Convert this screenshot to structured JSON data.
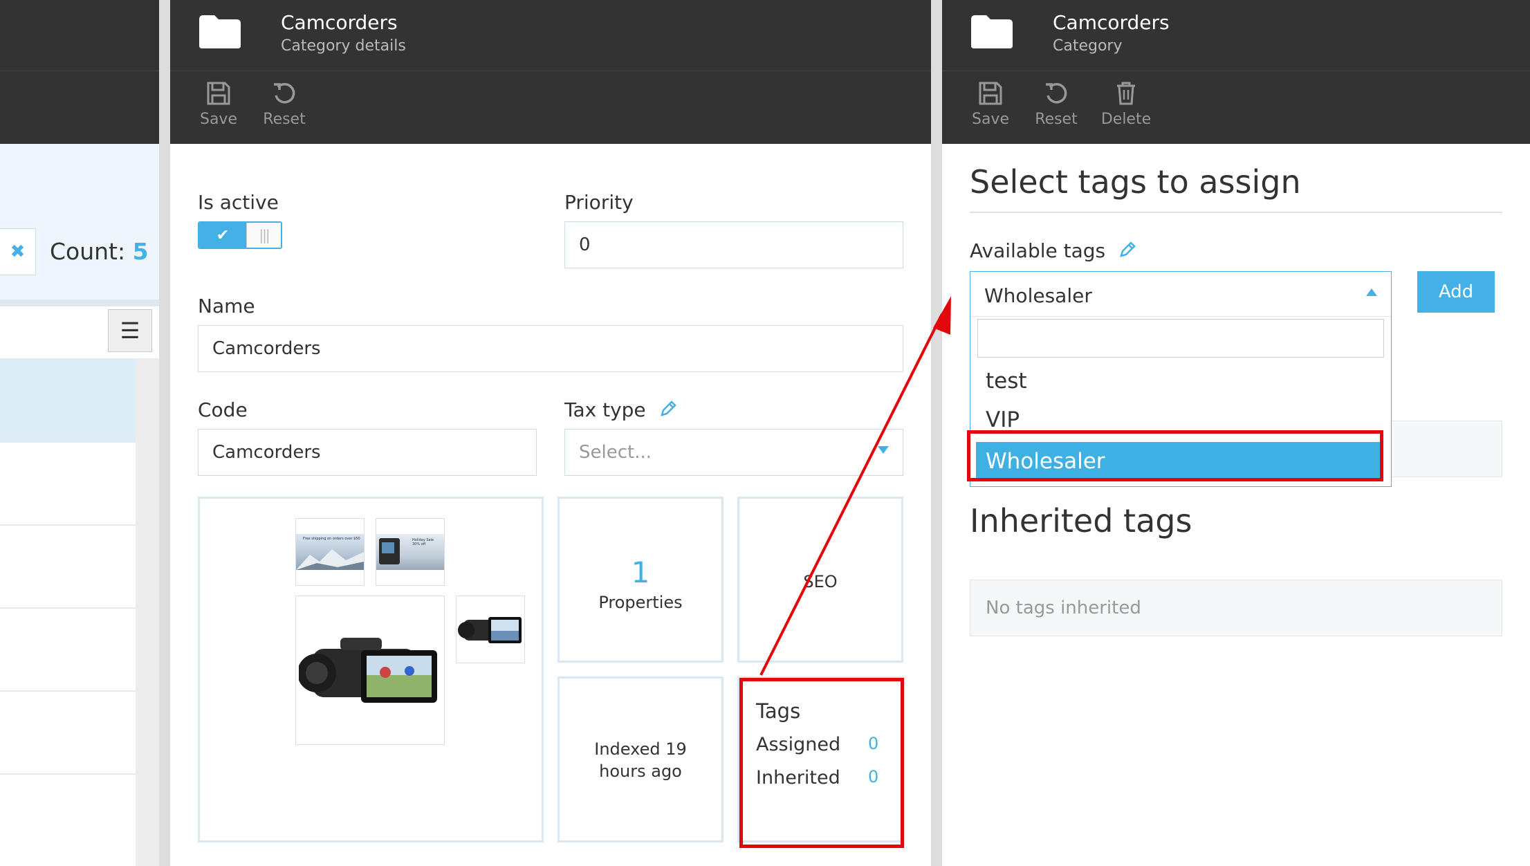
{
  "list_blade": {
    "count_label": "Count:",
    "count_value": "5",
    "clear_icon": "close-icon",
    "menu_icon": "hamburger-icon"
  },
  "details_blade": {
    "title": "Camcorders",
    "subtitle": "Category details",
    "toolbar": {
      "save_label": "Save",
      "reset_label": "Reset"
    },
    "is_active_label": "Is active",
    "is_active": true,
    "priority_label": "Priority",
    "priority_value": "0",
    "name_label": "Name",
    "name_value": "Camcorders",
    "code_label": "Code",
    "code_value": "Camcorders",
    "tax_type_label": "Tax type",
    "tax_type_placeholder": "Select...",
    "properties_count": "1",
    "properties_label": "Properties",
    "seo_label": "SEO",
    "indexed_label": "Indexed 19 hours ago",
    "tags_widget": {
      "title": "Tags",
      "assigned_label": "Assigned",
      "assigned_value": "0",
      "inherited_label": "Inherited",
      "inherited_value": "0"
    },
    "banner1_text": "Free shipping on orders over $50",
    "banner2_text": "Holiday Sale 30% off"
  },
  "tags_blade": {
    "title": "Camcorders",
    "subtitle": "Category",
    "toolbar": {
      "save_label": "Save",
      "reset_label": "Reset",
      "delete_label": "Delete"
    },
    "heading": "Select tags to assign",
    "available_label": "Available tags",
    "selected_value": "Wholesaler",
    "search_value": "",
    "options": [
      "test",
      "VIP",
      "Wholesaler"
    ],
    "highlighted_option": "Wholesaler",
    "add_label": "Add",
    "inherited_heading": "Inherited tags",
    "no_tags_text": "No tags inherited"
  },
  "colors": {
    "accent": "#43b0e6",
    "header": "#333333",
    "annotation_red": "#e3060b"
  }
}
